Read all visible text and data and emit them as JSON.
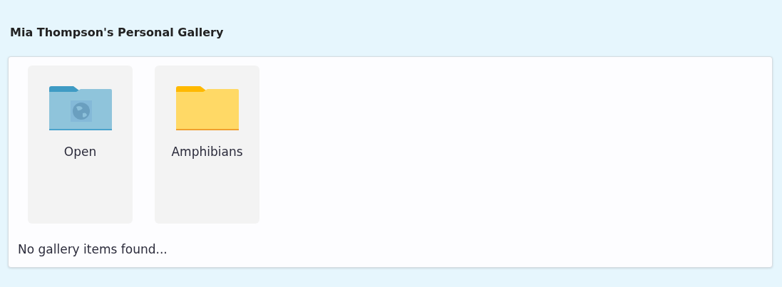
{
  "title": "Mia Thompson's Personal Gallery",
  "folders": [
    {
      "name": "Open",
      "kind": "public"
    },
    {
      "name": "Amphibians",
      "kind": "private"
    }
  ],
  "empty_message": "No gallery items found..."
}
